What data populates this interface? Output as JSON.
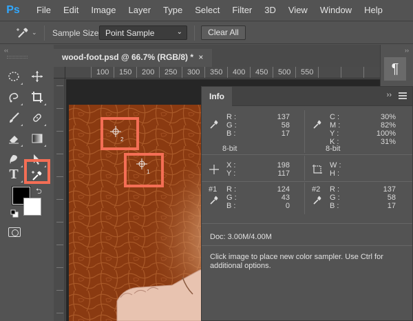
{
  "app": {
    "logo": "Ps"
  },
  "menu": [
    "File",
    "Edit",
    "Image",
    "Layer",
    "Type",
    "Select",
    "Filter",
    "3D",
    "View",
    "Window",
    "Help"
  ],
  "options": {
    "sample_size_label": "Sample Size:",
    "sample_size_value": "Point Sample",
    "clear_all": "Clear All"
  },
  "document": {
    "tab_title": "wood-foot.psd @ 66.7% (RGB/8) *",
    "close_glyph": "×",
    "ruler_marks": [
      "100",
      "150",
      "200",
      "250",
      "300",
      "350",
      "400",
      "450",
      "500",
      "550"
    ]
  },
  "colors": {
    "accent_highlight": "#f46e55",
    "foreground": "#000000",
    "background": "#ffffff",
    "logo": "#31a8ff"
  },
  "canvas": {
    "samplers": [
      "2",
      "1"
    ]
  },
  "right_dock": {
    "paragraph_glyph": "¶"
  },
  "info": {
    "tab": "Info",
    "rgb": {
      "labels": [
        "R :",
        "G :",
        "B :"
      ],
      "values": [
        "137",
        "58",
        "17"
      ],
      "bitdepth": "8-bit"
    },
    "cmyk": {
      "labels": [
        "C :",
        "M :",
        "Y :",
        "K :"
      ],
      "values": [
        "30%",
        "82%",
        "100%",
        "31%"
      ],
      "bitdepth": "8-bit"
    },
    "xy": {
      "labels": [
        "X :",
        "Y :"
      ],
      "values": [
        "198",
        "117"
      ]
    },
    "wh": {
      "labels": [
        "W :",
        "H :"
      ]
    },
    "sampler1": {
      "id": "#1",
      "labels": [
        "R :",
        "G :",
        "B :"
      ],
      "values": [
        "124",
        "43",
        "0"
      ]
    },
    "sampler2": {
      "id": "#2",
      "labels": [
        "R :",
        "G :",
        "B :"
      ],
      "values": [
        "137",
        "58",
        "17"
      ]
    },
    "doc_size": "Doc: 3.00M/4.00M",
    "hint": "Click image to place new color sampler.  Use Ctrl for additional options."
  }
}
